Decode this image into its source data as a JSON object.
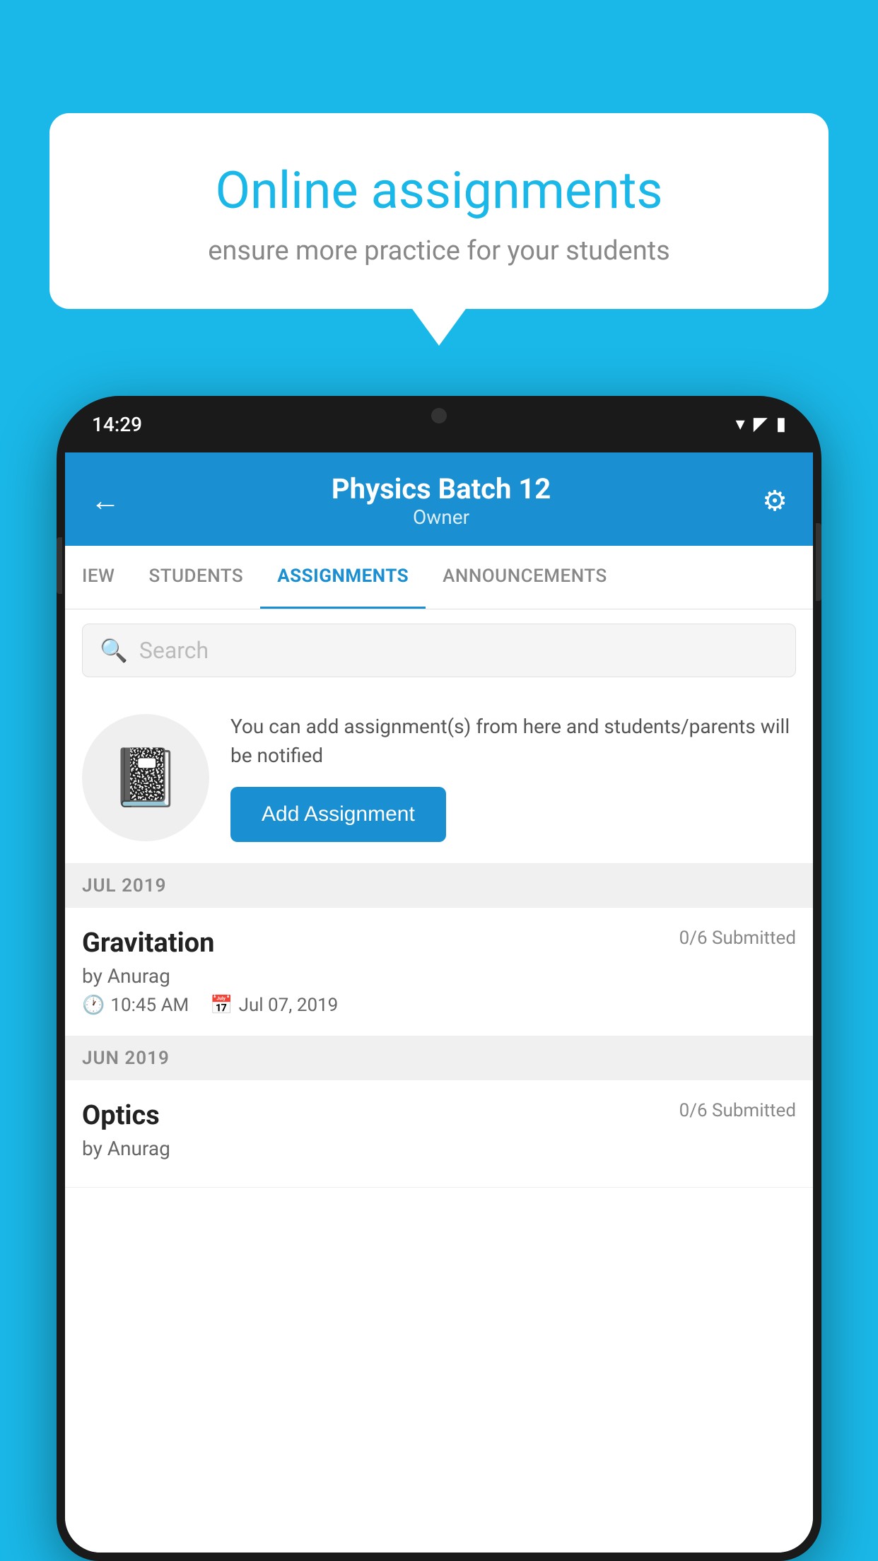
{
  "background_color": "#1ab8e8",
  "promo": {
    "title": "Online assignments",
    "subtitle": "ensure more practice for your students"
  },
  "phone": {
    "status_time": "14:29",
    "header": {
      "title": "Physics Batch 12",
      "subtitle": "Owner",
      "back_label": "←",
      "settings_label": "⚙"
    },
    "tabs": [
      {
        "label": "IEW",
        "active": false
      },
      {
        "label": "STUDENTS",
        "active": false
      },
      {
        "label": "ASSIGNMENTS",
        "active": true
      },
      {
        "label": "ANNOUNCEMENTS",
        "active": false
      }
    ],
    "search": {
      "placeholder": "Search"
    },
    "add_assignment": {
      "description": "You can add assignment(s) from here and students/parents will be notified",
      "button_label": "Add Assignment"
    },
    "sections": [
      {
        "month": "JUL 2019",
        "assignments": [
          {
            "name": "Gravitation",
            "submitted": "0/6 Submitted",
            "by": "by Anurag",
            "time": "10:45 AM",
            "date": "Jul 07, 2019"
          }
        ]
      },
      {
        "month": "JUN 2019",
        "assignments": [
          {
            "name": "Optics",
            "submitted": "0/6 Submitted",
            "by": "by Anurag",
            "time": "",
            "date": ""
          }
        ]
      }
    ]
  }
}
